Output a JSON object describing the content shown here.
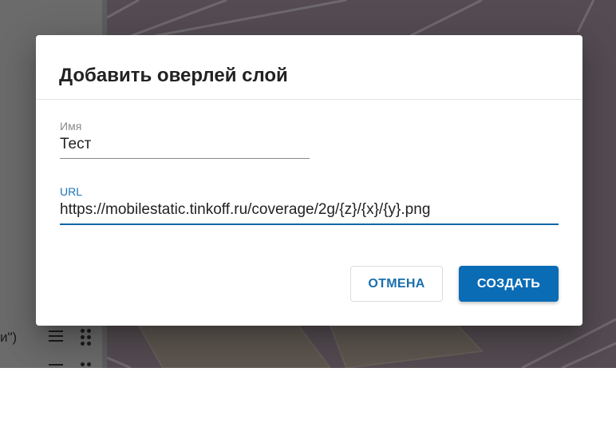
{
  "dialog": {
    "title": "Добавить оверлей слой",
    "name_field": {
      "label": "Имя",
      "value": "Тест"
    },
    "url_field": {
      "label": "URL",
      "value": "https://mobilestatic.tinkoff.ru/coverage/2g/{z}/{x}/{y}.png"
    },
    "cancel_label": "ОТМЕНА",
    "create_label": "СОЗДАТЬ"
  },
  "sidebar": {
    "rows": [
      {
        "text_fragment": "и\")"
      },
      {
        "text_fragment": ""
      }
    ]
  },
  "colors": {
    "primary": "#0a6cb5",
    "active_label": "#1a73b8",
    "backdrop": "rgba(0,0,0,0.32)"
  }
}
